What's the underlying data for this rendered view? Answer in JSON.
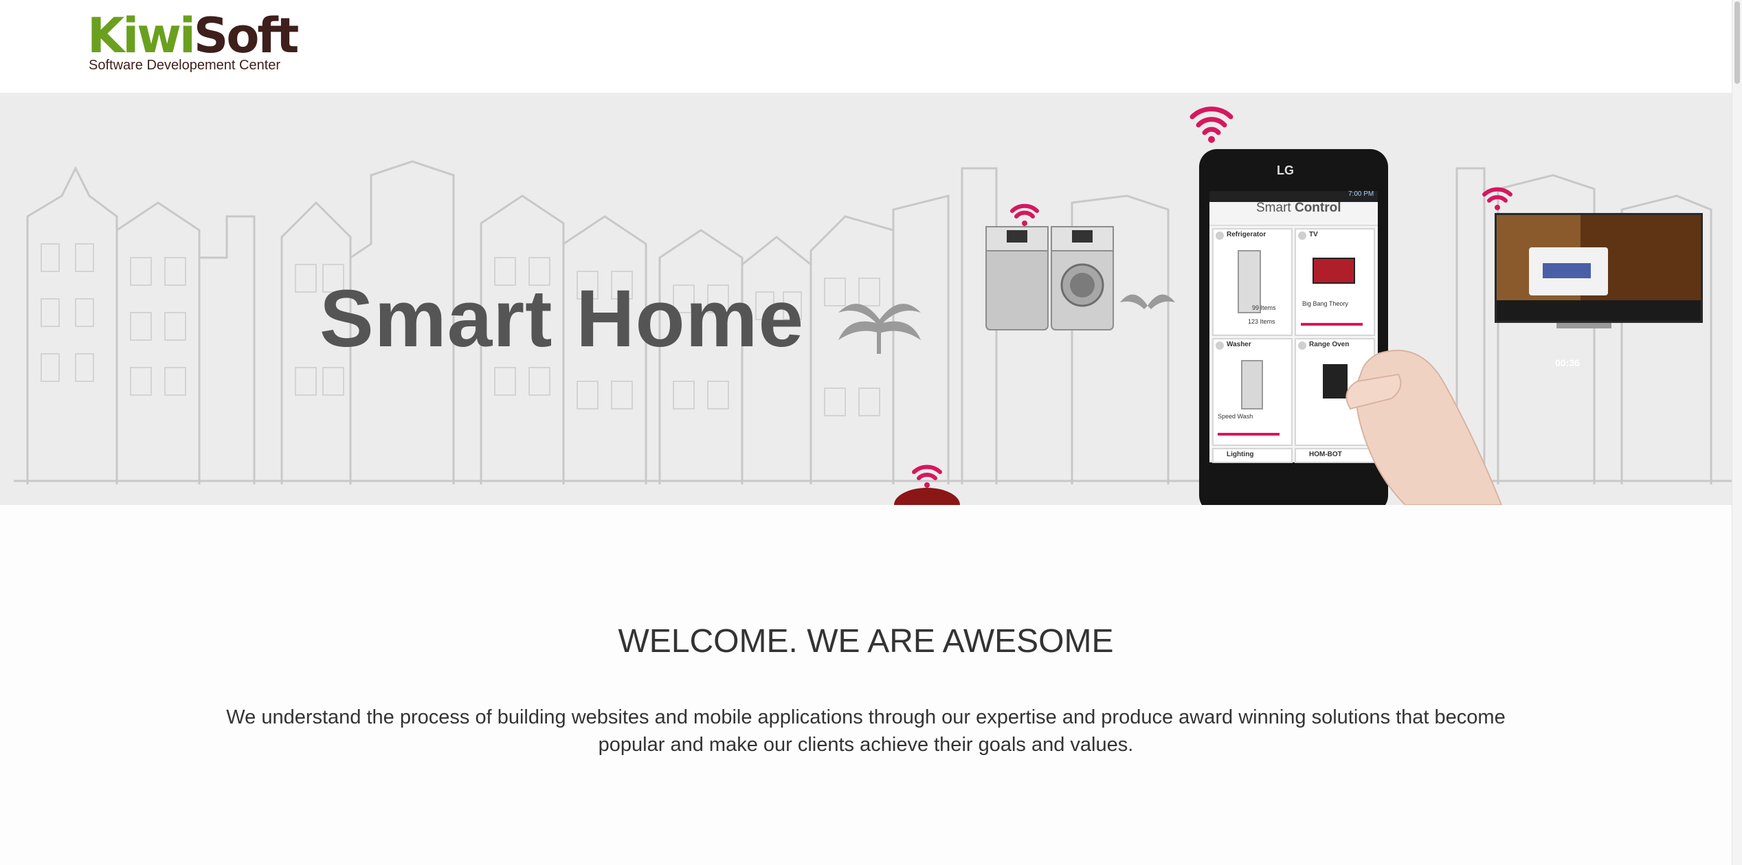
{
  "logo": {
    "word_part1": "Kiwi",
    "word_part2": "Soft",
    "tagline": "Software Developement Center",
    "colors": {
      "kiwi": "#6aa01e",
      "soft": "#3e1f1b"
    }
  },
  "banner": {
    "title": "Smart Home",
    "phone": {
      "brand": "LG",
      "time": "7:00 PM",
      "app_title_light": "Smart",
      "app_title_bold": "Control",
      "tiles": [
        {
          "label": "Refrigerator",
          "lines": [
            "99 Items",
            "123 Items"
          ]
        },
        {
          "label": "TV",
          "lines": [
            "Big Bang Theory"
          ]
        },
        {
          "label": "Washer",
          "lines": [
            "Speed Wash"
          ]
        },
        {
          "label": "Range Oven",
          "lines": []
        },
        {
          "label": "Lighting",
          "lines": []
        },
        {
          "label": "HOM-BOT",
          "lines": []
        }
      ]
    },
    "tv_screen_value": "00:36",
    "accent_color": "#d6175f"
  },
  "welcome": {
    "title": "WELCOME. WE ARE AWESOME",
    "text": "We understand the process of building websites and mobile applications through our expertise and produce award winning solutions that become popular and make our clients achieve their goals and values."
  }
}
